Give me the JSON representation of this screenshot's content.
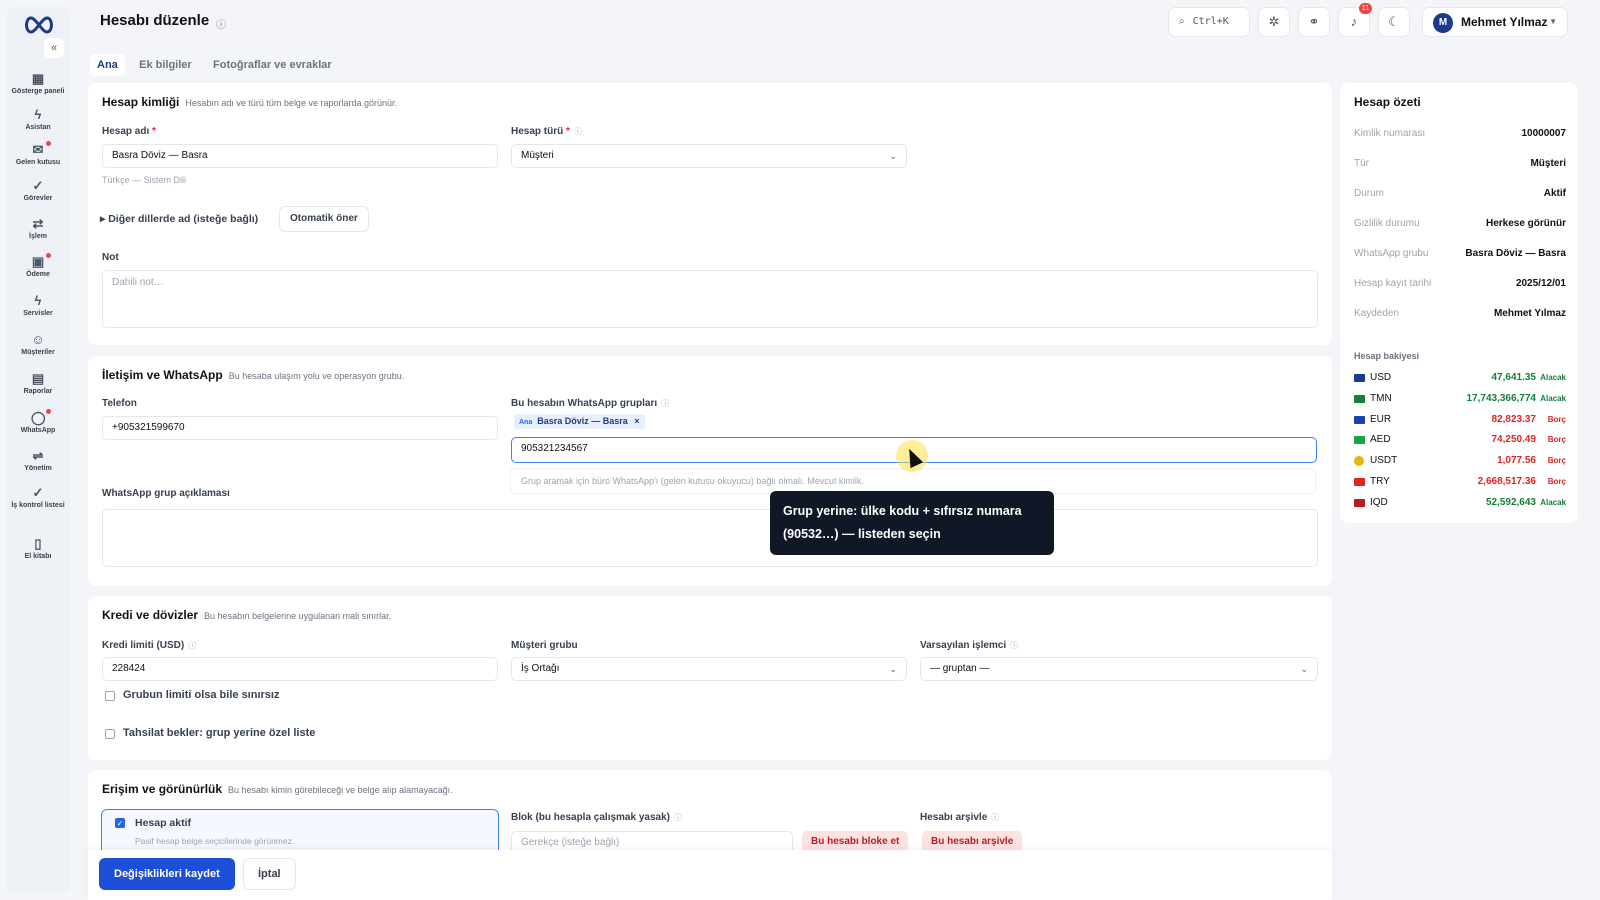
{
  "sidebar": {
    "items": [
      {
        "label": "Gösterge paneli",
        "icon": "dashboard-icon",
        "glyph": "▦"
      },
      {
        "label": "Asistan",
        "icon": "bolt-icon",
        "glyph": "ϟ"
      },
      {
        "label": "Gelen kutusu",
        "icon": "inbox-icon",
        "glyph": "✉"
      },
      {
        "label": "Görevler",
        "icon": "check-icon",
        "glyph": "✓"
      },
      {
        "label": "İşlem",
        "icon": "transfer-icon",
        "glyph": "⇄"
      },
      {
        "label": "Ödeme",
        "icon": "wallet-icon",
        "glyph": "▣"
      },
      {
        "label": "Servisler",
        "icon": "lightning-icon",
        "glyph": "ϟ"
      },
      {
        "label": "Müşteriler",
        "icon": "users-icon",
        "glyph": "☺"
      },
      {
        "label": "Raporlar",
        "icon": "report-icon",
        "glyph": "▤"
      },
      {
        "label": "WhatsApp",
        "icon": "chat-icon",
        "glyph": "◯"
      },
      {
        "label": "Yönetim",
        "icon": "sliders-icon",
        "glyph": "⇌"
      },
      {
        "label": "İş kontrol listesi",
        "icon": "checklist-icon",
        "glyph": "✓"
      },
      {
        "label": "El kitabı",
        "icon": "book-icon",
        "glyph": "▯"
      }
    ]
  },
  "header": {
    "title": "Hesabı düzenle",
    "search_shortcut": "Ctrl+K",
    "notification_count": "11",
    "user_initial": "M",
    "user_name": "Mehmet Yılmaz"
  },
  "tabs": [
    "Ana",
    "Ek bilgiler",
    "Fotoğraflar ve evraklar"
  ],
  "identity": {
    "title": "Hesap kimliği",
    "subtitle": "Hesabın adı ve türü tüm belge ve raporlarda görünür.",
    "name_label": "Hesap adı",
    "name_value": "Basra Döviz — Basra",
    "name_hint": "Türkçe — Sistem Dili",
    "type_label": "Hesap türü",
    "type_value": "Müşteri",
    "other_langs": "Diğer dillerde ad (isteğe bağlı)",
    "auto_suggest": "Otomatik öner",
    "note_label": "Not",
    "note_placeholder": "Dahili not…"
  },
  "contact": {
    "title": "İletişim ve WhatsApp",
    "subtitle": "Bu hesaba ulaşım yolu ve operasyon grubu.",
    "phone_label": "Telefon",
    "phone_value": "+905321599670",
    "groups_label": "Bu hesabın WhatsApp grupları",
    "chip_tag": "Ana",
    "chip_label": "Basra Döviz — Basra",
    "search_value": "905321234567",
    "dropdown_hint": "Grup aramak için büro WhatsApp'ı (gelen kutusu okuyucu) bağlı olmalı. Mevcut kimlik.",
    "desc_label": "WhatsApp grup açıklaması",
    "tooltip": "Grup yerine: ülke kodu + sıfırsız numara (90532…) — listeden seçin"
  },
  "credit": {
    "title": "Kredi ve dövizler",
    "subtitle": "Bu hesabın belgelerine uygulanan mali sınırlar.",
    "limit_label": "Kredi limiti (USD)",
    "limit_value": "228424",
    "group_label": "Müşteri grubu",
    "group_value": "İş Ortağı",
    "handler_label": "Varsayılan işlemci",
    "handler_value": "— gruptan —",
    "unlimited_label": "Grubun limiti olsa bile sınırsız",
    "collection_label": "Tahsilat bekler: grup yerine özel liste"
  },
  "access": {
    "title": "Erişim ve görünürlük",
    "subtitle": "Bu hesabı kimin görebileceği ve belge alıp alamayacağı.",
    "active_label": "Hesap aktif",
    "active_hint": "Pasif hesap belge seçicilerinde görünmez.",
    "block_label": "Blok (bu hesapla çalışmak yasak)",
    "block_placeholder": "Gerekçe (isteğe bağlı)",
    "block_button": "Bu hesabı bloke et",
    "archive_label": "Hesabı arşivle",
    "archive_button": "Bu hesabı arşivle"
  },
  "footer": {
    "save": "Değişiklikleri kaydet",
    "cancel": "İptal"
  },
  "summary": {
    "title": "Hesap özeti",
    "rows": [
      {
        "k": "Kimlik numarası",
        "v": "10000007"
      },
      {
        "k": "Tür",
        "v": "Müşteri"
      },
      {
        "k": "Durum",
        "v": "Aktif"
      },
      {
        "k": "Gizlilik durumu",
        "v": "Herkese görünür"
      },
      {
        "k": "WhatsApp grubu",
        "v": "Basra Döviz — Basra"
      },
      {
        "k": "Hesap kayıt tarihi",
        "v": "2025/12/01"
      },
      {
        "k": "Kaydeden",
        "v": "Mehmet Yılmaz"
      }
    ],
    "balance_title": "Hesap bakiyesi",
    "balances": [
      {
        "cur": "USD",
        "amt": "47,641.35",
        "st": "Alacak",
        "color": "#1e3a8a"
      },
      {
        "cur": "TMN",
        "amt": "17,743,366,774",
        "st": "Alacak",
        "color": "#15803d"
      },
      {
        "cur": "EUR",
        "amt": "82,823.37",
        "st": "Borç",
        "color": "#1e40af"
      },
      {
        "cur": "AED",
        "amt": "74,250.49",
        "st": "Borç",
        "color": "#16a34a"
      },
      {
        "cur": "USDT",
        "amt": "1,077.56",
        "st": "Borç",
        "color": "#eab308"
      },
      {
        "cur": "TRY",
        "amt": "2,668,517.36",
        "st": "Borç",
        "color": "#dc2626"
      },
      {
        "cur": "IQD",
        "amt": "52,592,643",
        "st": "Alacak",
        "color": "#b91c1c"
      }
    ]
  }
}
